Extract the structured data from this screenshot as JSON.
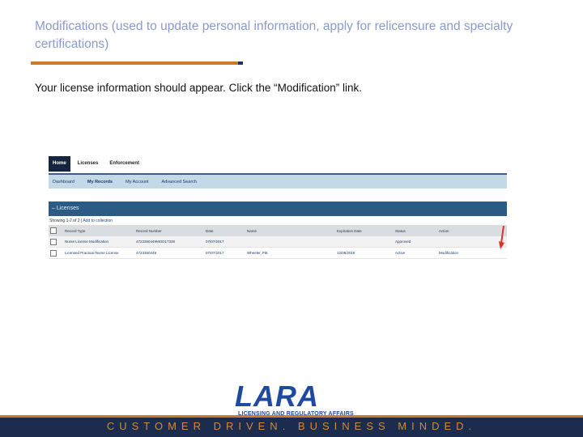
{
  "slide": {
    "title": "Modifications  (used to update personal information, apply for relicensure and specialty certifications)",
    "instruction": "Your license information should appear. Click the “Modification” link."
  },
  "screenshot": {
    "top_nav": [
      "Home",
      "Licenses",
      "Enforcement"
    ],
    "sub_nav": [
      "Dashboard",
      "My Records",
      "My Account",
      "Advanced Search"
    ],
    "section_title": "Licenses",
    "showing_text": "Showing 1-2 of 2 | ",
    "add_to_collection": "Add to collection",
    "columns": [
      "Record Type",
      "Record Number",
      "Date",
      "Name",
      "Expiration Date",
      "Status",
      "Action"
    ],
    "rows": [
      [
        "Nurse License Modification",
        "4723350449MOD17328",
        "07/07/2017",
        "",
        "",
        "Approved",
        ""
      ],
      [
        "Licensed Practical Nurse License",
        "4723350449",
        "07/07/2017",
        "Wheeler, Pitt",
        "12/08/2018",
        "Active",
        "Modification"
      ]
    ],
    "arrow_color": "#e0302a"
  },
  "logo": {
    "name": "LARA",
    "subtitle": "LICENSING AND REGULATORY AFFAIRS"
  },
  "footer": {
    "tagline": "CUSTOMER DRIVEN. BUSINESS MINDED."
  },
  "colors": {
    "title": "#8a9bc9",
    "accent_orange": "#c97a2b",
    "navy": "#1b2c4f"
  }
}
